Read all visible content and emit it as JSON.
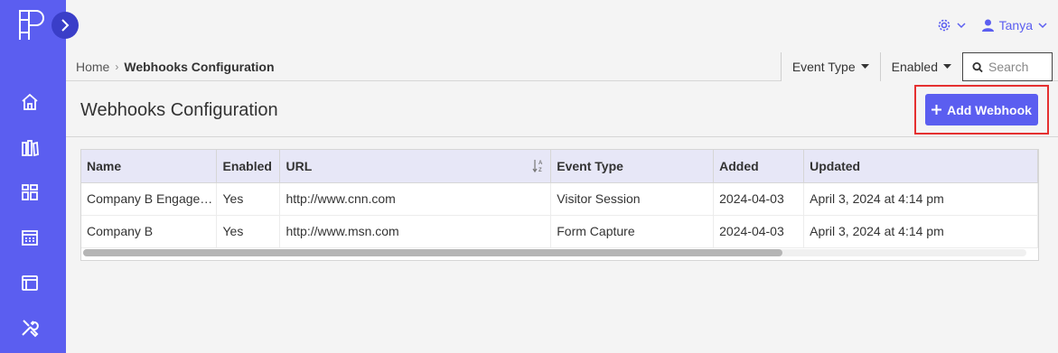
{
  "user": {
    "name": "Tanya"
  },
  "breadcrumb": {
    "home": "Home",
    "current": "Webhooks Configuration"
  },
  "filters": {
    "event_type": "Event Type",
    "enabled": "Enabled",
    "search_placeholder": "Search"
  },
  "page": {
    "title": "Webhooks Configuration",
    "add_button": "Add Webhook"
  },
  "table": {
    "columns": [
      "Name",
      "Enabled",
      "URL",
      "Event Type",
      "Added",
      "Updated"
    ],
    "rows": [
      [
        "Company B Engage…",
        "Yes",
        "http://www.cnn.com",
        "Visitor Session",
        "2024-04-03",
        "April 3, 2024 at 4:14 pm"
      ],
      [
        "Company B",
        "Yes",
        "http://www.msn.com",
        "Form Capture",
        "2024-04-03",
        "April 3, 2024 at 4:14 pm"
      ]
    ]
  },
  "colors": {
    "accent": "#5b5ef0",
    "highlight": "#e53030",
    "header_bg": "#e7e7f7"
  },
  "icons": {
    "sidebar": [
      "home-icon",
      "library-icon",
      "dashboard-icon",
      "calendar-icon",
      "browser-window-icon",
      "tools-icon"
    ]
  }
}
